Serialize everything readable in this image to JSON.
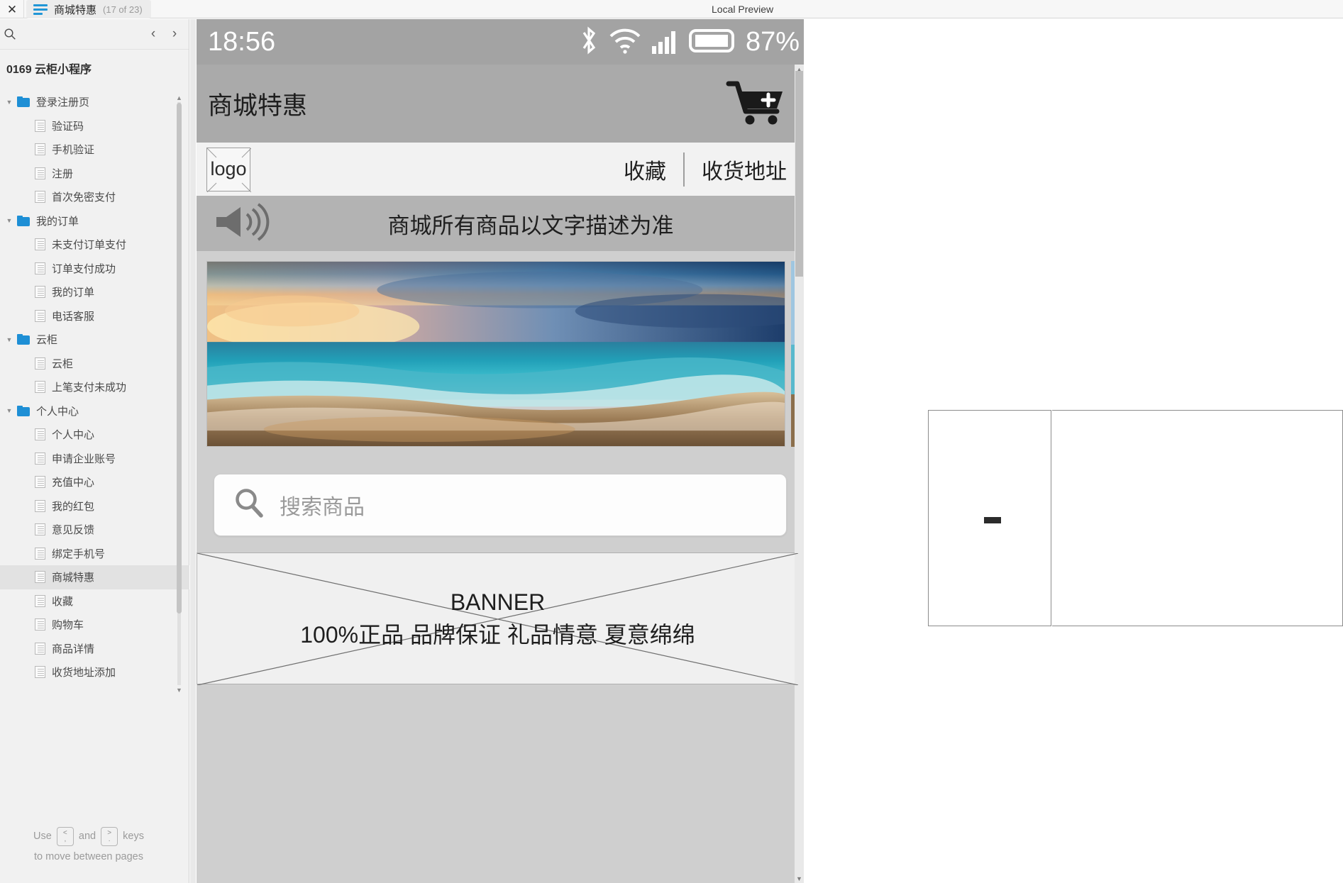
{
  "topbar": {
    "close_icon": "close-icon",
    "menu_icon": "hamburger-icon",
    "tab_title": "商城特惠",
    "tab_count": "(17 of 23)",
    "local_preview": "Local Preview"
  },
  "sidebar": {
    "search_icon": "search-icon",
    "prev_icon": "chevron-left-icon",
    "next_icon": "chevron-right-icon",
    "project_id": "0169",
    "project_name": "云柜小程序",
    "tree": [
      {
        "type": "folder",
        "label": "登录注册页",
        "expanded": true
      },
      {
        "type": "page",
        "label": "验证码"
      },
      {
        "type": "page",
        "label": "手机验证"
      },
      {
        "type": "page",
        "label": "注册"
      },
      {
        "type": "page",
        "label": "首次免密支付"
      },
      {
        "type": "folder",
        "label": "我的订单",
        "expanded": true
      },
      {
        "type": "page",
        "label": "未支付订单支付"
      },
      {
        "type": "page",
        "label": "订单支付成功"
      },
      {
        "type": "page",
        "label": "我的订单"
      },
      {
        "type": "page",
        "label": "电话客服"
      },
      {
        "type": "folder",
        "label": "云柜",
        "expanded": true
      },
      {
        "type": "page",
        "label": "云柜"
      },
      {
        "type": "page",
        "label": "上笔支付未成功"
      },
      {
        "type": "folder",
        "label": "个人中心",
        "expanded": true
      },
      {
        "type": "page",
        "label": "个人中心"
      },
      {
        "type": "page",
        "label": "申请企业账号"
      },
      {
        "type": "page",
        "label": "充值中心"
      },
      {
        "type": "page",
        "label": "我的红包"
      },
      {
        "type": "page",
        "label": "意见反馈"
      },
      {
        "type": "page",
        "label": "绑定手机号"
      },
      {
        "type": "page",
        "label": "商城特惠",
        "selected": true
      },
      {
        "type": "page",
        "label": "收藏"
      },
      {
        "type": "page",
        "label": "购物车"
      },
      {
        "type": "page",
        "label": "商品详情"
      },
      {
        "type": "page",
        "label": "收货地址添加"
      }
    ],
    "hint_prefix": "Use",
    "hint_and": "and",
    "hint_suffix": "keys",
    "hint_line2": "to move between pages",
    "key_prev_top": "<",
    "key_prev_bottom": ",",
    "key_next_top": ">",
    "key_next_bottom": "."
  },
  "preview": {
    "status": {
      "time": "18:56",
      "bluetooth_icon": "bluetooth-icon",
      "wifi_icon": "wifi-icon",
      "signal_icon": "cellular-signal-icon",
      "battery_icon": "battery-icon",
      "battery_percent": "87%"
    },
    "app_title": "商城特惠",
    "cart_icon": "cart-plus-icon",
    "logo_label": "logo",
    "actions": [
      {
        "label": "收藏"
      },
      {
        "label": "收货地址"
      }
    ],
    "announcement": {
      "speaker_icon": "speaker-icon",
      "text": "商城所有商品以文字描述为准"
    },
    "search": {
      "icon": "search-icon",
      "placeholder": "搜索商品",
      "value": ""
    },
    "banner": {
      "line1": "BANNER",
      "line2": "100%正品 品牌保证 礼品情意 夏意绵绵"
    }
  },
  "colors": {
    "accent": "#1e8fd5",
    "statusbar": "#a3a3a3",
    "apptitle": "#aaaaaa",
    "announce": "#b3b3b3",
    "page_bg": "#cfcfcf",
    "sidebar_bg": "#f1f1f1",
    "selected_row": "#e2e2e2"
  }
}
